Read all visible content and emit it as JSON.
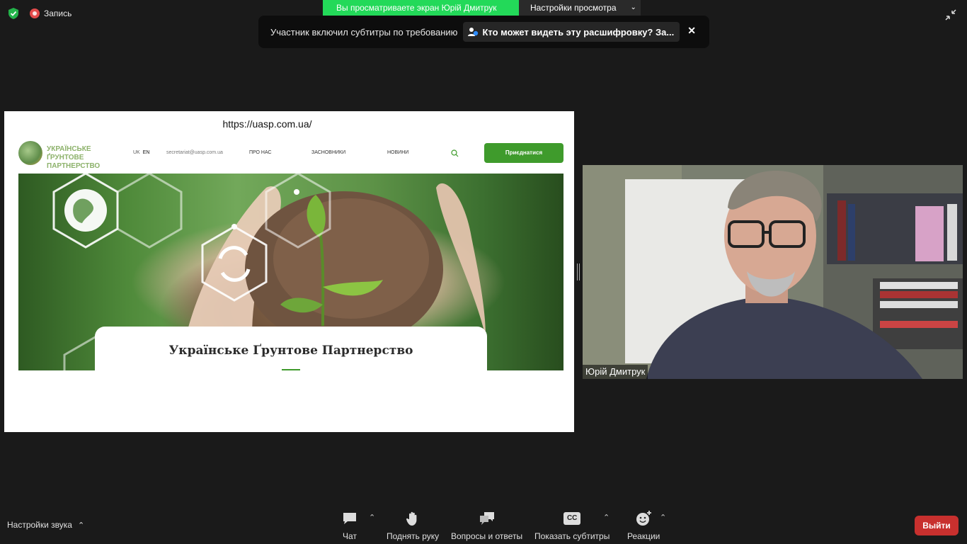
{
  "top": {
    "recording_label": "Запись",
    "share_banner": "Вы просматриваете экран Юрій Дмитрук",
    "view_settings": "Настройки просмотра"
  },
  "toast": {
    "text": "Участник включил субтитры по требованию",
    "link": "Кто может видеть эту расшифровку? За...",
    "close": "✕"
  },
  "shared_screen": {
    "url": "https://uasp.com.ua/",
    "logo_text": "УКРАЇНСЬКЕ ҐРУНТОВЕ ПАРТНЕРСТВО",
    "lang_uk": "UK",
    "lang_en": "EN",
    "email": "secretariat@uasp.com.ua",
    "nav": [
      "ПРО НАС",
      "ЗАСНОВНИКИ",
      "НОВИНИ"
    ],
    "join": "Приєднатися",
    "hero_title": "Українське Ґрунтове Партнерство"
  },
  "video": {
    "participant_name": "Юрій Дмитрук"
  },
  "toolbar": {
    "sound_settings": "Настройки звука",
    "chat": "Чат",
    "raise_hand": "Поднять руку",
    "qa": "Вопросы и ответы",
    "captions": "Показать субтитры",
    "cc_badge": "CC",
    "reactions": "Реакции",
    "leave": "Выйти"
  },
  "colors": {
    "share_green": "#23d959",
    "leave_red": "#c8302e",
    "site_green": "#3f9b2c"
  }
}
